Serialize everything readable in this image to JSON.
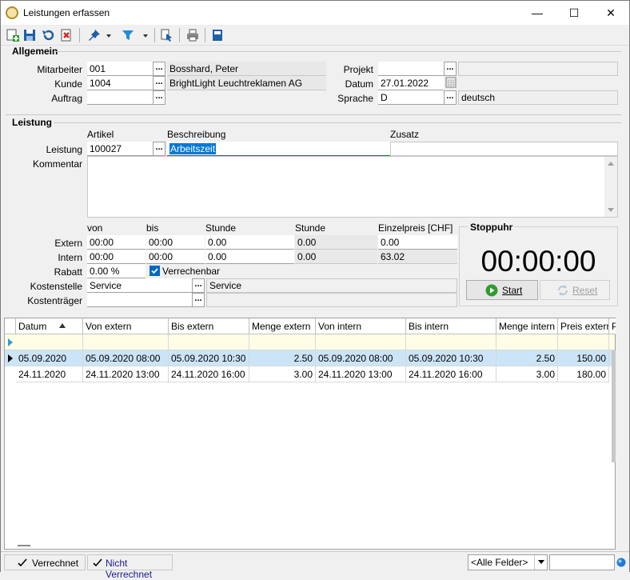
{
  "window": {
    "title": "Leistungen erfassen"
  },
  "allgemein": {
    "title": "Allgemein",
    "mitarbeiter_label": "Mitarbeiter",
    "mitarbeiter_value": "001",
    "mitarbeiter_name": "Bosshard, Peter",
    "kunde_label": "Kunde",
    "kunde_value": "1004",
    "kunde_name": "BrightLight Leuchtreklamen AG",
    "auftrag_label": "Auftrag",
    "auftrag_value": "",
    "projekt_label": "Projekt",
    "projekt_value": "",
    "datum_label": "Datum",
    "datum_value": "27.01.2022",
    "sprache_label": "Sprache",
    "sprache_value": "D",
    "sprache_name": "deutsch"
  },
  "leistung": {
    "title": "Leistung",
    "artikel_header": "Artikel",
    "beschreibung_header": "Beschreibung",
    "zusatz_header": "Zusatz",
    "leistung_label": "Leistung",
    "leistung_value": "100027",
    "beschreibung_value": "Arbeitszeit",
    "zusatz_value": "",
    "kommentar_label": "Kommentar",
    "col_von": "von",
    "col_bis": "bis",
    "col_stunde1": "Stunde",
    "col_stunde2": "Stunde",
    "col_einzelpreis": "Einzelpreis [CHF]",
    "extern_label": "Extern",
    "extern_von": "00:00",
    "extern_bis": "00:00",
    "extern_stunde": "0.00",
    "extern_stunde2": "0.00",
    "extern_preis": "0.00",
    "intern_label": "Intern",
    "intern_von": "00:00",
    "intern_bis": "00:00",
    "intern_stunde": "0.00",
    "intern_stunde2": "0.00",
    "intern_preis": "63.02",
    "rabatt_label": "Rabatt",
    "rabatt_value": "0.00 %",
    "verrechenbar_label": "Verrechenbar",
    "kostenstelle_label": "Kostenstelle",
    "kostenstelle_value": "Service",
    "kostenstelle_name": "Service",
    "kostentraeger_label": "Kostenträger",
    "kostentraeger_value": ""
  },
  "stoppuhr": {
    "title": "Stoppuhr",
    "time": "00:00:00",
    "start_label": "Start",
    "reset_label": "Reset"
  },
  "grid": {
    "headers": [
      "Datum",
      "Von extern",
      "Bis extern",
      "Menge extern",
      "Von intern",
      "Bis intern",
      "Menge intern",
      "Preis extern",
      "P"
    ],
    "rows": [
      [
        "05.09.2020",
        "05.09.2020  08:00",
        "05.09.2020  10:30",
        "2.50",
        "05.09.2020  08:00",
        "05.09.2020  10:30",
        "2.50",
        "150.00"
      ],
      [
        "24.11.2020",
        "24.11.2020  13:00",
        "24.11.2020  16:00",
        "3.00",
        "24.11.2020  13:00",
        "24.11.2020  16:00",
        "3.00",
        "180.00"
      ]
    ]
  },
  "statusbar": {
    "verrechnet": "Verrechnet",
    "nicht_verrechnet": "Nicht Verrechnet",
    "filter_value": "<Alle Felder>"
  },
  "colors": {
    "accent": "#0066cc",
    "selected_row": "#cce4f7",
    "start_green": "#2e9d2e"
  }
}
